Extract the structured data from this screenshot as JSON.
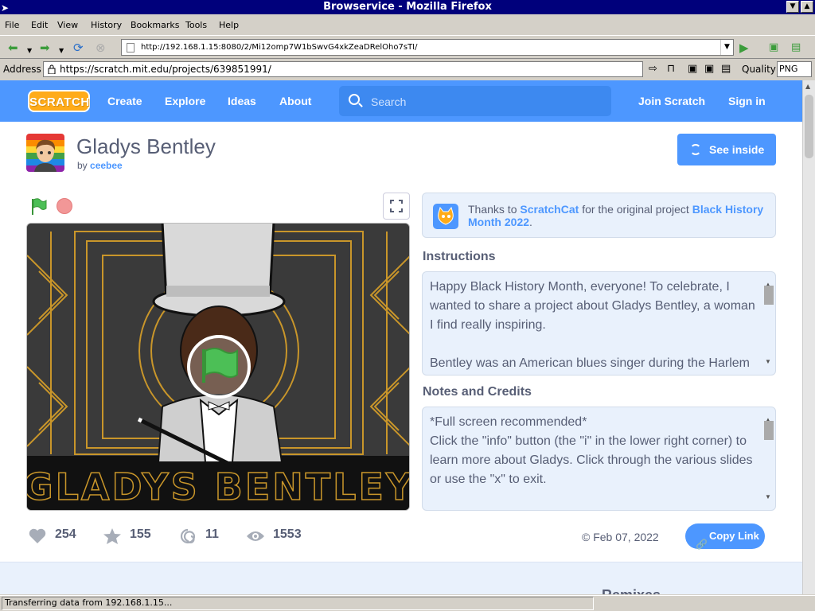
{
  "window": {
    "title": "Browservice - Mozilla Firefox"
  },
  "menu": {
    "items": [
      "File",
      "Edit",
      "View",
      "History",
      "Bookmarks",
      "Tools",
      "Help"
    ]
  },
  "nav": {
    "url": "http://192.168.1.15:8080/2/Mi12omp7W1bSwvG4xkZeaDRelOho7sTI/"
  },
  "address": {
    "label": "Address",
    "url": "https://scratch.mit.edu/projects/639851991/",
    "quality_label": "Quality",
    "quality_value": "PNG"
  },
  "scratch_nav": {
    "logo": "SCRATCH",
    "create": "Create",
    "explore": "Explore",
    "ideas": "Ideas",
    "about": "About",
    "search_placeholder": "Search",
    "join": "Join Scratch",
    "signin": "Sign in"
  },
  "project": {
    "title": "Gladys Bentley",
    "by": "by",
    "author": "ceebee",
    "see_inside": "See inside",
    "stage_title": "GLADYS BENTLEY"
  },
  "thanks": {
    "prefix": "Thanks to",
    "user": "ScratchCat",
    "middle": "for the original project",
    "project": "Black History Month 2022",
    "suffix": "."
  },
  "instructions": {
    "heading": "Instructions",
    "lines": [
      "Happy Black History Month, everyone! To celebrate, I",
      "wanted to share a project about Gladys Bentley, a woman",
      "I find really inspiring.",
      "",
      "Bentley was an American blues singer during the Harlem"
    ]
  },
  "notes": {
    "heading": "Notes and Credits",
    "lines": [
      "*Full screen recommended*",
      "Click the \"info\" button (the \"i\" in the lower right corner) to",
      "learn more about Gladys. Click through the various slides",
      "or use the \"x\" to exit."
    ]
  },
  "stats": {
    "loves": "254",
    "favorites": "155",
    "remixes": "11",
    "views": "1553"
  },
  "date": "© Feb 07, 2022",
  "copy_link": "Copy Link",
  "remixes_heading": "Remixes",
  "status": "Transferring data from 192.168.1.15...",
  "colors": {
    "scratch_blue": "#4d97ff",
    "scratch_text": "#575e75",
    "panel_bg": "#e9f1fc",
    "title_bar": "#00007b"
  }
}
